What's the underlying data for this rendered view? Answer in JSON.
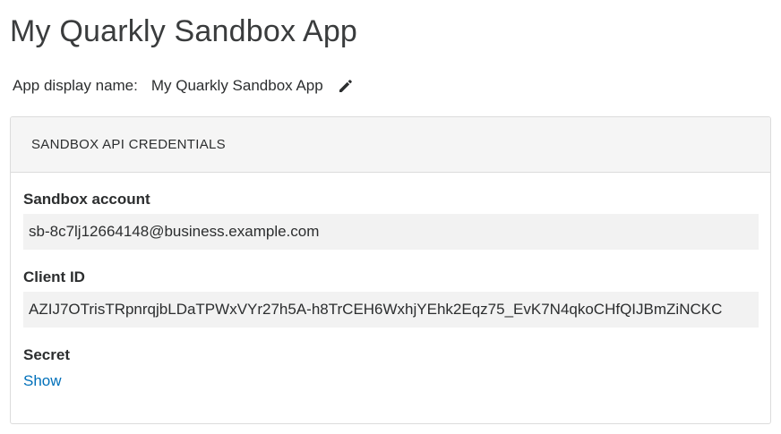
{
  "page": {
    "title": "My Quarkly Sandbox App"
  },
  "display_name": {
    "label": "App display name:",
    "value": "My Quarkly Sandbox App",
    "edit_icon": "pencil-icon"
  },
  "credentials": {
    "header": "SANDBOX API CREDENTIALS",
    "sandbox_account": {
      "label": "Sandbox account",
      "value": "sb-8c7lj12664148@business.example.com"
    },
    "client_id": {
      "label": "Client ID",
      "value": "AZIJ7OTrisTRpnrqjbLDaTPWxVYr27h5A-h8TrCEH6WxhjYEhk2Eqz75_EvK7N4qkoCHfQIJBmZiNCKC"
    },
    "secret": {
      "label": "Secret",
      "show_label": "Show"
    }
  },
  "colors": {
    "link": "#0070ba",
    "header_bg": "#f5f5f5",
    "field_bg": "#f2f2f2",
    "border": "#dcdcdc"
  }
}
